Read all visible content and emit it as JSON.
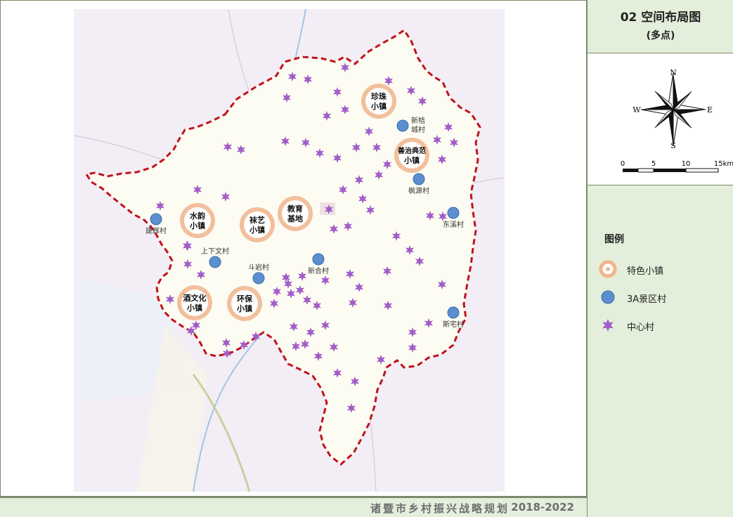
{
  "title": {
    "main": "02 空间布局图",
    "sub": "(多点)"
  },
  "compass": {
    "north": "N",
    "south": "S",
    "east": "E",
    "west": "W"
  },
  "scale_bar": {
    "ticks": [
      "0",
      "5",
      "10",
      "15km"
    ]
  },
  "legend": {
    "title": "图例",
    "items": [
      {
        "label": "特色小镇",
        "symbol": "town-ring-icon",
        "color": "#f0b48c"
      },
      {
        "label": "3A景区村",
        "symbol": "blue-dot-icon",
        "color": "#5b8fd0"
      },
      {
        "label": "中心村",
        "symbol": "purple-star-icon",
        "color": "#a25ec8"
      }
    ]
  },
  "towns": [
    {
      "line1": "珍珠",
      "line2": "小镇"
    },
    {
      "line1": "善治典范",
      "line2": "小镇"
    },
    {
      "line1": "水韵",
      "line2": "小镇"
    },
    {
      "line1": "袜艺",
      "line2": "小镇"
    },
    {
      "line1": "教育",
      "line2": "基地"
    },
    {
      "line1": "酒文化",
      "line2": "小镇"
    },
    {
      "line1": "环保",
      "line2": "小镇"
    }
  ],
  "villages_3a": [
    {
      "name": "新桔",
      "name2": "城村"
    },
    {
      "name": "枫源村",
      "name2": ""
    },
    {
      "name": "东溪村",
      "name2": ""
    },
    {
      "name": "建辉村",
      "name2": ""
    },
    {
      "name": "上下文村",
      "name2": ""
    },
    {
      "name": "斗岩村",
      "name2": ""
    },
    {
      "name": "新合村",
      "name2": ""
    },
    {
      "name": "斯宅村",
      "name2": ""
    }
  ],
  "footer": {
    "text": "诸暨市乡村振兴战略规划",
    "years": "2018-2022"
  },
  "colors": {
    "boundary": "#c0121c",
    "town_ring": "#f0b48c",
    "village_3a": "#5b8fd0",
    "center_village": "#a25ec8",
    "panel_bg": "#e3efdb"
  }
}
